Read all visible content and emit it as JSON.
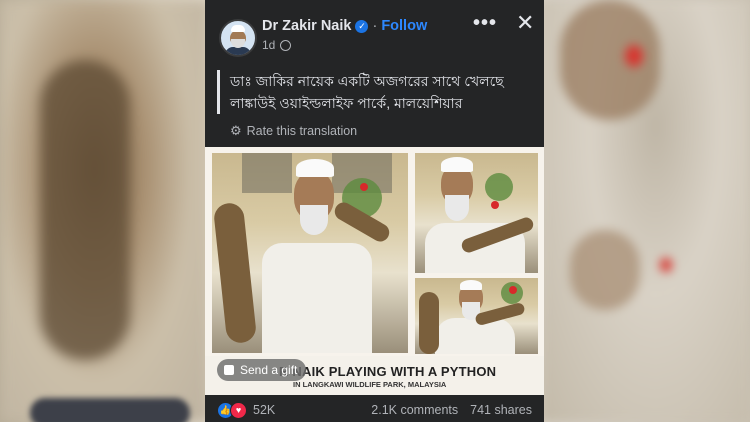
{
  "post": {
    "author": "Dr Zakir Naik",
    "follow_label": "Follow",
    "separator": "·",
    "time": "1d",
    "caption": "ডাঃ জাকির নায়েক একটি অজগরের সাথে খেলছে লাঙ্কাউই ওয়াইল্ডলাইফ পার্কে, মালয়েশিয়ার",
    "translate_label": "Rate this translation",
    "image_title": "R NAIK PLAYING WITH A PYTHON",
    "image_subtitle": "IN LANGKAWI WILDLIFE PARK, MALAYSIA",
    "gift_label": "Send a gift",
    "reaction_count": "52K",
    "comments": "2.1K comments",
    "shares": "741 shares"
  },
  "icons": {
    "verified": "verified-badge-icon",
    "globe": "globe-icon",
    "more": "more-options-icon",
    "close": "close-icon",
    "gear": "gear-icon",
    "gift": "gift-icon",
    "like": "like-reaction-icon",
    "love": "love-reaction-icon"
  },
  "colors": {
    "card_bg": "#242526",
    "accent": "#2d88ff",
    "like": "#1b74e4",
    "love": "#f02849"
  }
}
